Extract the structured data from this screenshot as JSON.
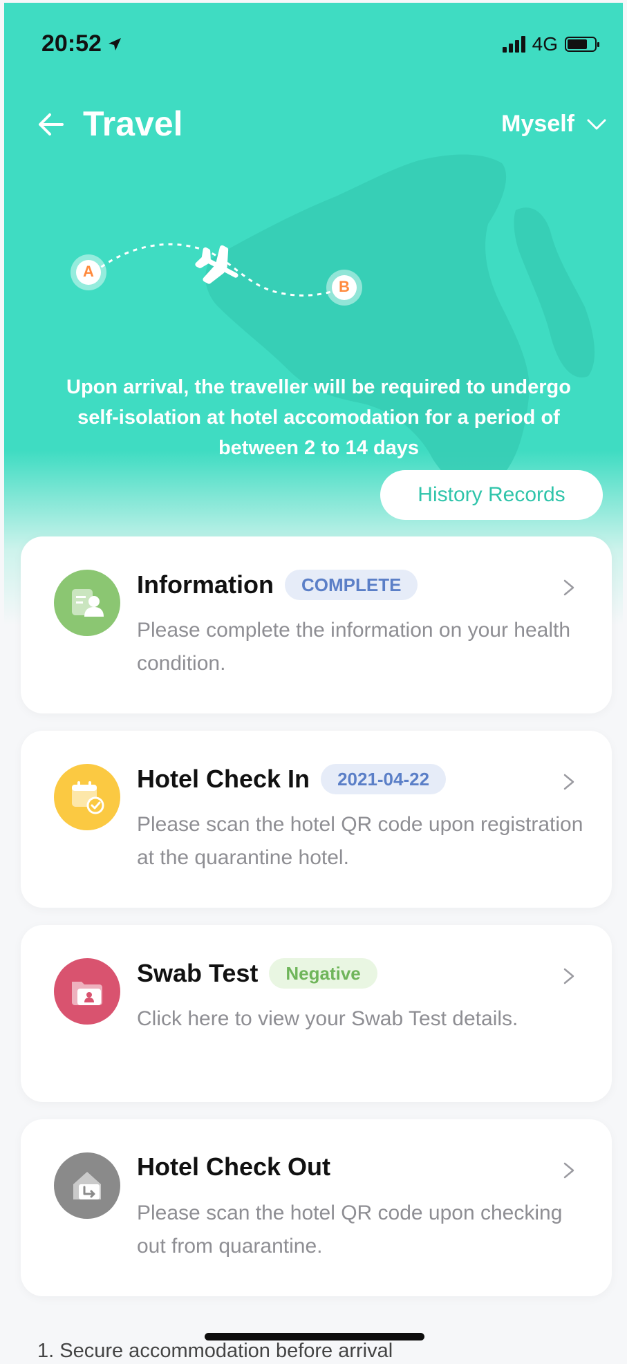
{
  "status_bar": {
    "time": "20:52",
    "network": "4G",
    "signal_bars": 4
  },
  "header": {
    "title": "Travel",
    "profile_label": "Myself"
  },
  "route": {
    "origin": "A",
    "destination": "B"
  },
  "notice": "Upon arrival, the traveller will be required to undergo self-isolation at hotel accomodation for a period of between 2 to 14 days",
  "history_button": "History Records",
  "cards": [
    {
      "title": "Information",
      "badge": "COMPLETE",
      "badge_color": "#5b7fc7",
      "badge_bg": "#e6ecf8",
      "description": "Please complete the information on your health condition.",
      "icon_bg": "#8bc672",
      "icon": "profile-card-icon"
    },
    {
      "title": "Hotel Check In",
      "badge": "2021-04-22",
      "badge_color": "#5b7fc7",
      "badge_bg": "#e6ecf8",
      "description": "Please scan the hotel QR code upon registration at the quarantine hotel.",
      "icon_bg": "#fbc942",
      "icon": "calendar-check-icon"
    },
    {
      "title": "Swab Test",
      "badge": "Negative",
      "badge_color": "#6fb55a",
      "badge_bg": "#e9f6e2",
      "description": "Click here to view your Swab Test details.",
      "icon_bg": "#d9536f",
      "icon": "folder-person-icon"
    },
    {
      "title": "Hotel Check Out",
      "badge": "",
      "description": "Please scan the hotel QR code upon checking out from quarantine.",
      "icon_bg": "#8a8a8a",
      "icon": "house-exit-icon"
    }
  ],
  "footnote": "1. Secure accommodation before arrival"
}
